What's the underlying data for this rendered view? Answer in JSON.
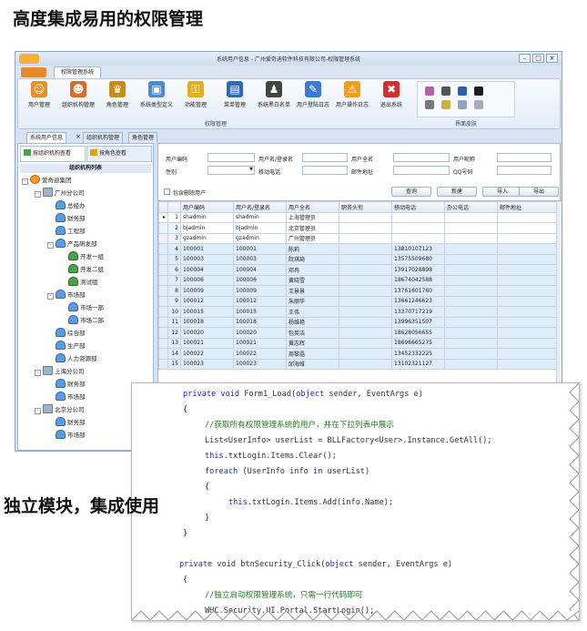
{
  "header_title": "高度集成易用的权限管理",
  "subtitle": "独立模块，集成使用",
  "window": {
    "title": "系统用户信息 - 广州爱奇迪软件科技有限公司-权限管理系统",
    "ribbon_tab": "权限管理系统"
  },
  "ribbon": {
    "buttons": [
      {
        "label": "用户管理",
        "icon": "user-icon"
      },
      {
        "label": "组织机构管理",
        "icon": "org-icon"
      },
      {
        "label": "角色管理",
        "icon": "role-icon"
      },
      {
        "label": "系统类型定义",
        "icon": "system-type-icon"
      },
      {
        "label": "功能管理",
        "icon": "key-icon"
      },
      {
        "label": "菜单管理",
        "icon": "menu-book-icon"
      },
      {
        "label": "系统黑白名单",
        "icon": "blacklist-icon"
      },
      {
        "label": "用户登陆日志",
        "icon": "login-log-icon"
      },
      {
        "label": "用户操作日志",
        "icon": "warning-icon"
      },
      {
        "label": "退出系统",
        "icon": "exit-icon"
      }
    ],
    "group_label": "权限管理",
    "skin_label": "界面皮肤"
  },
  "doc_tabs": [
    "系统用户信息",
    "组织机构管理",
    "角色管理"
  ],
  "left_panel": {
    "btn_by_org": "按组织机构查看",
    "btn_by_role": "按角色查看",
    "tree_title": "组织机构列表",
    "tree": [
      {
        "label": "爱奇迪集团",
        "level": 0,
        "kind": "root",
        "expander": "-"
      },
      {
        "label": "广州分公司",
        "level": 1,
        "kind": "org",
        "expander": "-"
      },
      {
        "label": "总经办",
        "level": 2,
        "kind": "dept"
      },
      {
        "label": "财务部",
        "level": 2,
        "kind": "dept"
      },
      {
        "label": "工程部",
        "level": 2,
        "kind": "dept"
      },
      {
        "label": "产品研发部",
        "level": 2,
        "kind": "dept",
        "expander": "-"
      },
      {
        "label": "开发一组",
        "level": 3,
        "kind": "sub"
      },
      {
        "label": "开发二组",
        "level": 3,
        "kind": "sub"
      },
      {
        "label": "测试组",
        "level": 3,
        "kind": "sub"
      },
      {
        "label": "市场部",
        "level": 2,
        "kind": "dept",
        "expander": "-"
      },
      {
        "label": "市场一部",
        "level": 3,
        "kind": "dept"
      },
      {
        "label": "市场二部",
        "level": 3,
        "kind": "dept"
      },
      {
        "label": "综合部",
        "level": 2,
        "kind": "dept"
      },
      {
        "label": "生产部",
        "level": 2,
        "kind": "dept"
      },
      {
        "label": "人力资源部",
        "level": 2,
        "kind": "dept"
      },
      {
        "label": "上海分公司",
        "level": 1,
        "kind": "org",
        "expander": "-"
      },
      {
        "label": "财务部",
        "level": 2,
        "kind": "dept"
      },
      {
        "label": "市场部",
        "level": 2,
        "kind": "dept"
      },
      {
        "label": "北京分公司",
        "level": 1,
        "kind": "org",
        "expander": "-"
      },
      {
        "label": "财务部",
        "level": 2,
        "kind": "dept"
      },
      {
        "label": "市场部",
        "level": 2,
        "kind": "dept"
      }
    ]
  },
  "search": {
    "user_code": "用户编码",
    "login_name": "用户名/登录名",
    "full_name": "用户全名",
    "nickname": "用户昵称",
    "gender": "性别",
    "mobile": "移动电话",
    "email": "邮件地址",
    "qq": "QQ号码",
    "include_deleted": "包含删除用户",
    "query_btn": "查询",
    "new_btn": "新建",
    "import_btn": "导入",
    "export_btn": "导出"
  },
  "grid": {
    "columns": [
      "用户编码",
      "用户名/登录名",
      "用户全名",
      "职务头衔",
      "移动电话",
      "办公电话",
      "邮件地址"
    ],
    "rows": [
      [
        "1",
        "shadmin",
        "shadmin",
        "上海管理员",
        "",
        "",
        "",
        ""
      ],
      [
        "2",
        "bjadmin",
        "bjadmin",
        "北京管理员",
        "",
        "",
        "",
        ""
      ],
      [
        "3",
        "gzadmin",
        "gzadmin",
        "广州管理员",
        "",
        "",
        "",
        ""
      ],
      [
        "4",
        "100001",
        "100001",
        "陈莉",
        "",
        "13810107123",
        "",
        ""
      ],
      [
        "5",
        "100003",
        "100003",
        "阮琪琦",
        "",
        "13575509680",
        "",
        ""
      ],
      [
        "6",
        "100004",
        "100004",
        "邓冉",
        "",
        "13917028898",
        "",
        ""
      ],
      [
        "7",
        "100006",
        "100006",
        "黄晓雪",
        "",
        "18674042588",
        "",
        ""
      ],
      [
        "8",
        "100009",
        "100009",
        "王景景",
        "",
        "13761601760",
        "",
        ""
      ],
      [
        "9",
        "100012",
        "100012",
        "朱丽华",
        "",
        "13661246623",
        "",
        ""
      ],
      [
        "10",
        "100015",
        "100015",
        "王伟",
        "",
        "13370717219",
        "",
        ""
      ],
      [
        "11",
        "100018",
        "100018",
        "杨维艳",
        "",
        "13996351507",
        "",
        ""
      ],
      [
        "12",
        "100020",
        "100020",
        "包英洁",
        "",
        "18628056655",
        "",
        ""
      ],
      [
        "13",
        "100021",
        "100021",
        "黄志辉",
        "",
        "18696665275",
        "",
        ""
      ],
      [
        "14",
        "100022",
        "100022",
        "周黎晶",
        "",
        "13452332225",
        "",
        ""
      ],
      [
        "15",
        "100023",
        "100023",
        "邱海维",
        "",
        "13102321127",
        "",
        ""
      ]
    ],
    "selected_marker": "▸"
  },
  "code": {
    "lines": [
      {
        "indent": 0,
        "parts": [
          [
            "kw",
            "private void "
          ],
          [
            "",
            "Form1_Load("
          ],
          [
            "kw",
            "object"
          ],
          [
            "",
            " sender, EventArgs e)"
          ]
        ]
      },
      {
        "indent": 0,
        "parts": [
          [
            "",
            "{"
          ]
        ]
      },
      {
        "indent": 1,
        "parts": [
          [
            "cm",
            "//获取所有权限管理系统的用户，并在下拉列表中展示"
          ]
        ]
      },
      {
        "indent": 1,
        "parts": [
          [
            "",
            "List<UserInfo> userList = BLLFactory<User>.Instance.GetAll();"
          ]
        ]
      },
      {
        "indent": 1,
        "parts": [
          [
            "kw",
            "this"
          ],
          [
            "",
            ".txtLogin.Items.Clear();"
          ]
        ]
      },
      {
        "indent": 1,
        "parts": [
          [
            "kw",
            "foreach"
          ],
          [
            "",
            " (UserInfo info "
          ],
          [
            "kw",
            "in"
          ],
          [
            "",
            " userList)"
          ]
        ]
      },
      {
        "indent": 1,
        "parts": [
          [
            "",
            "{"
          ]
        ]
      },
      {
        "indent": 2,
        "parts": [
          [
            "kw",
            "this"
          ],
          [
            "",
            ".txtLogin.Items.Add(info.Name);"
          ]
        ]
      },
      {
        "indent": 1,
        "parts": [
          [
            "",
            "}"
          ]
        ]
      },
      {
        "indent": 0,
        "parts": [
          [
            "",
            "}"
          ]
        ]
      },
      {
        "indent": 0,
        "parts": [
          [
            "",
            ""
          ]
        ]
      },
      {
        "indent": 0,
        "parts": [
          [
            "kw",
            "private void "
          ],
          [
            "",
            "btnSecurity_Click("
          ],
          [
            "kw",
            "object"
          ],
          [
            "",
            " sender, EventArgs e)"
          ]
        ]
      },
      {
        "indent": 0,
        "parts": [
          [
            "",
            "{"
          ]
        ]
      },
      {
        "indent": 1,
        "parts": [
          [
            "cm",
            "//独立启动权限管理系统，只需一行代码即可"
          ]
        ]
      },
      {
        "indent": 1,
        "parts": [
          [
            "",
            "WHC.Security.UI.Portal.StartLogin();"
          ]
        ]
      },
      {
        "indent": 0,
        "parts": [
          [
            "",
            "}"
          ]
        ]
      }
    ]
  }
}
